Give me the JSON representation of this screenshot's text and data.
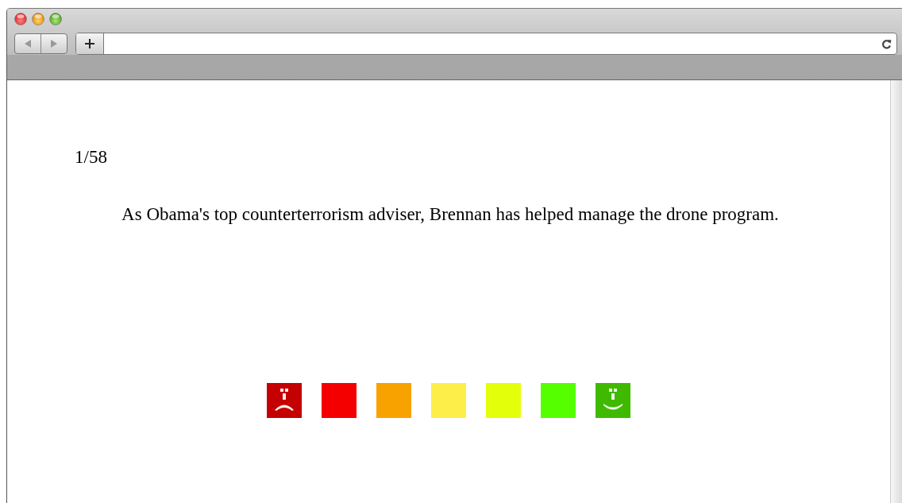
{
  "counter": "1/58",
  "statement": "As Obama's top counterterrorism adviser, Brennan has helped manage the drone program.",
  "ratings": [
    {
      "kind": "sad",
      "color": "#c40000"
    },
    {
      "kind": "plain",
      "color": "#f50000"
    },
    {
      "kind": "plain",
      "color": "#f8a200"
    },
    {
      "kind": "plain",
      "color": "#fdee4a"
    },
    {
      "kind": "plain",
      "color": "#e4ff0a"
    },
    {
      "kind": "plain",
      "color": "#55ff00"
    },
    {
      "kind": "happy",
      "color": "#3fba00"
    }
  ]
}
